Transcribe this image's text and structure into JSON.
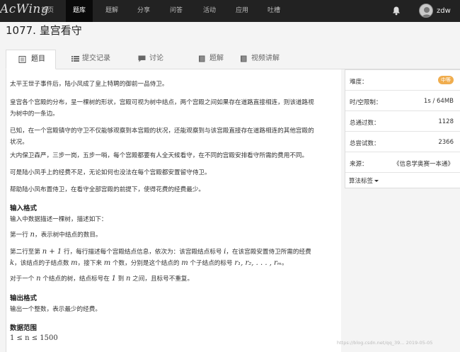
{
  "nav": {
    "logo": "AcWing",
    "items": [
      "首页",
      "题库",
      "题解",
      "分享",
      "问答",
      "活动",
      "应用",
      "吐槽"
    ],
    "active_index": 1,
    "username": "zdw"
  },
  "problem": {
    "title": "1077. 皇宫看守"
  },
  "tabs": [
    "题目",
    "提交记录",
    "讨论",
    "题解",
    "视频讲解"
  ],
  "content": {
    "p1": "太平王世子事件后，陆小凤成了皇上特聘的御前一品侍卫。",
    "p2a": "皇宫各个宫殿的分布，呈一棵树的形状，宫殿可视为树中结点，两个宫殿之间如果存在道路直接相连，则该道路视",
    "p2b": "为树中的一条边。",
    "p3a": "已知，在一个宫殿镇守的守卫不仅能够观察到本宫殿的状况，还能观察到与该宫殿直接存在道路相连的其他宫殿的",
    "p3b": "状况。",
    "p4": "大内保卫森严，三步一岗，五步一哨，每个宫殿都要有人全天候看守，在不同的宫殿安排看守所需的费用不同。",
    "p5": "可是陆小凤手上的经费不足，无论如何也没法在每个宫殿都安置留守侍卫。",
    "p6": "帮助陆小凤布置侍卫，在看守全部宫殿的前提下，使得花费的经费最少。",
    "h_input": "输入格式",
    "in1": "输入中数据描述一棵树，描述如下：",
    "in2_a": "第一行 ",
    "in2_n": "n",
    "in2_b": "，表示树中结点的数目。",
    "in3_a": "第二行至第 ",
    "in3_m": "n + 1",
    "in3_b": " 行，每行描述每个宫殿结点信息，依次为：该宫殿结点标号 ",
    "in3_i": "i",
    "in3_c": "，在该宫殿安置侍卫所需的经费",
    "in4_k": "k",
    "in4_a": "，该结点的子结点数 ",
    "in4_m1": "m",
    "in4_b": "，接下来 ",
    "in4_m2": "m",
    "in4_c": " 个数，分别是这个结点的 ",
    "in4_m3": "m",
    "in4_d": " 个子结点的标号 ",
    "in4_r": "r₁, r₂, . . . , rₘ",
    "in4_e": "。",
    "in5_a": "对于一个 ",
    "in5_n": "n",
    "in5_b": " 个结点的树，结点标号在 ",
    "in5_1": "1",
    "in5_c": " 到 ",
    "in5_n2": "n",
    "in5_d": " 之间，且标号不重复。",
    "h_output": "输出格式",
    "out1": "输出一个整数，表示最少的经费。",
    "h_range": "数据范围",
    "range": "1 ≤ n ≤ 1500"
  },
  "sidebar": {
    "difficulty_label": "难度：",
    "difficulty_value": "中等",
    "limit_label": "时/空限制：",
    "limit_value": "1s / 64MB",
    "passed_label": "总通过数：",
    "passed_value": "1128",
    "tried_label": "总尝试数：",
    "tried_value": "2366",
    "source_label": "来源：",
    "source_value": "《信息学奥赛一本通》",
    "tags_label": "算法标签"
  },
  "watermark": "https://blog.csdn.net/qq_39... 2019-05-05",
  "colors": {
    "navbar": "#222222",
    "badge": "#f0ad4e"
  }
}
